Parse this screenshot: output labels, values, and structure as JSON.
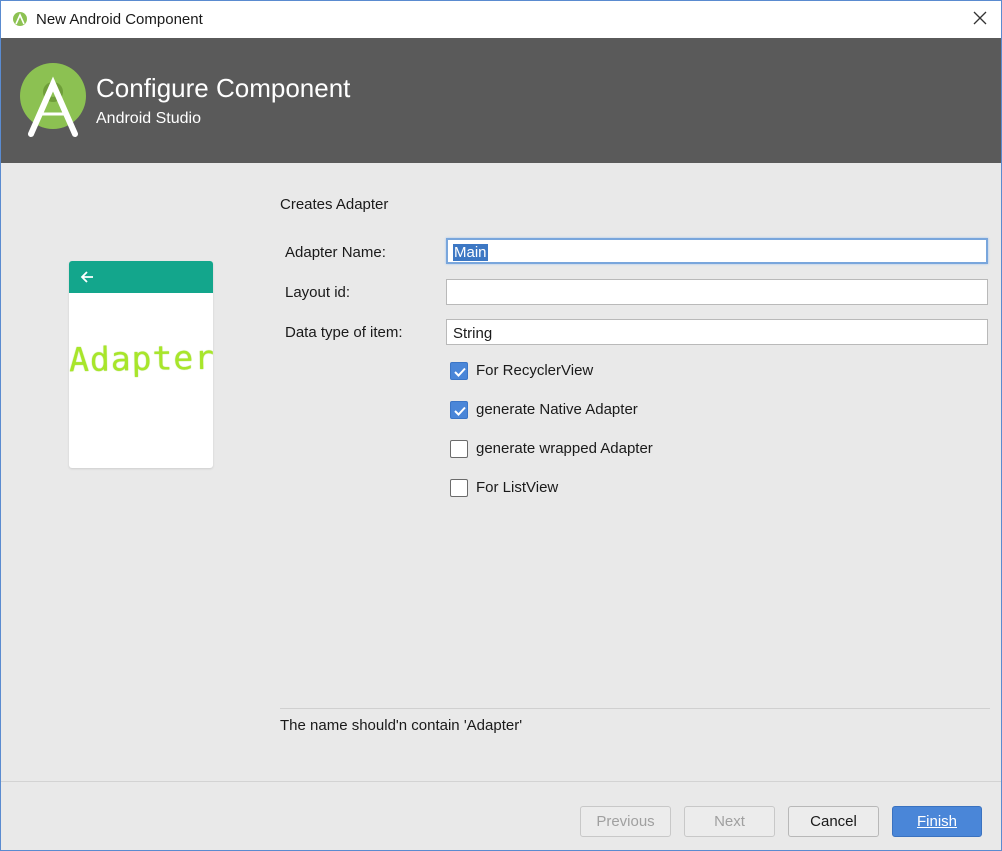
{
  "window": {
    "title": "New Android Component"
  },
  "banner": {
    "title": "Configure Component",
    "subtitle": "Android Studio"
  },
  "preview": {
    "card_text": "Adapter",
    "accent_color": "#13a68c"
  },
  "form": {
    "section_label": "Creates Adapter",
    "adapter_name": {
      "label": "Adapter Name:",
      "value": "Main"
    },
    "layout_id": {
      "label": "Layout id:",
      "value": ""
    },
    "data_type": {
      "label": "Data type of item:",
      "value": "String"
    },
    "checkboxes": [
      {
        "label": "For RecyclerView",
        "checked": true
      },
      {
        "label": "generate Native Adapter",
        "checked": true
      },
      {
        "label": "generate wrapped Adapter",
        "checked": false
      },
      {
        "label": "For ListView",
        "checked": false
      }
    ]
  },
  "message": "The name should'n contain 'Adapter'",
  "buttons": {
    "previous": {
      "label": "Previous",
      "enabled": false
    },
    "next": {
      "label": "Next",
      "enabled": false
    },
    "cancel": {
      "label": "Cancel",
      "enabled": true
    },
    "finish": {
      "label": "Finish",
      "enabled": true
    }
  },
  "colors": {
    "banner": "#5a5a5a",
    "primary_button": "#4a86d8",
    "checkbox_checked": "#4a86d8"
  }
}
